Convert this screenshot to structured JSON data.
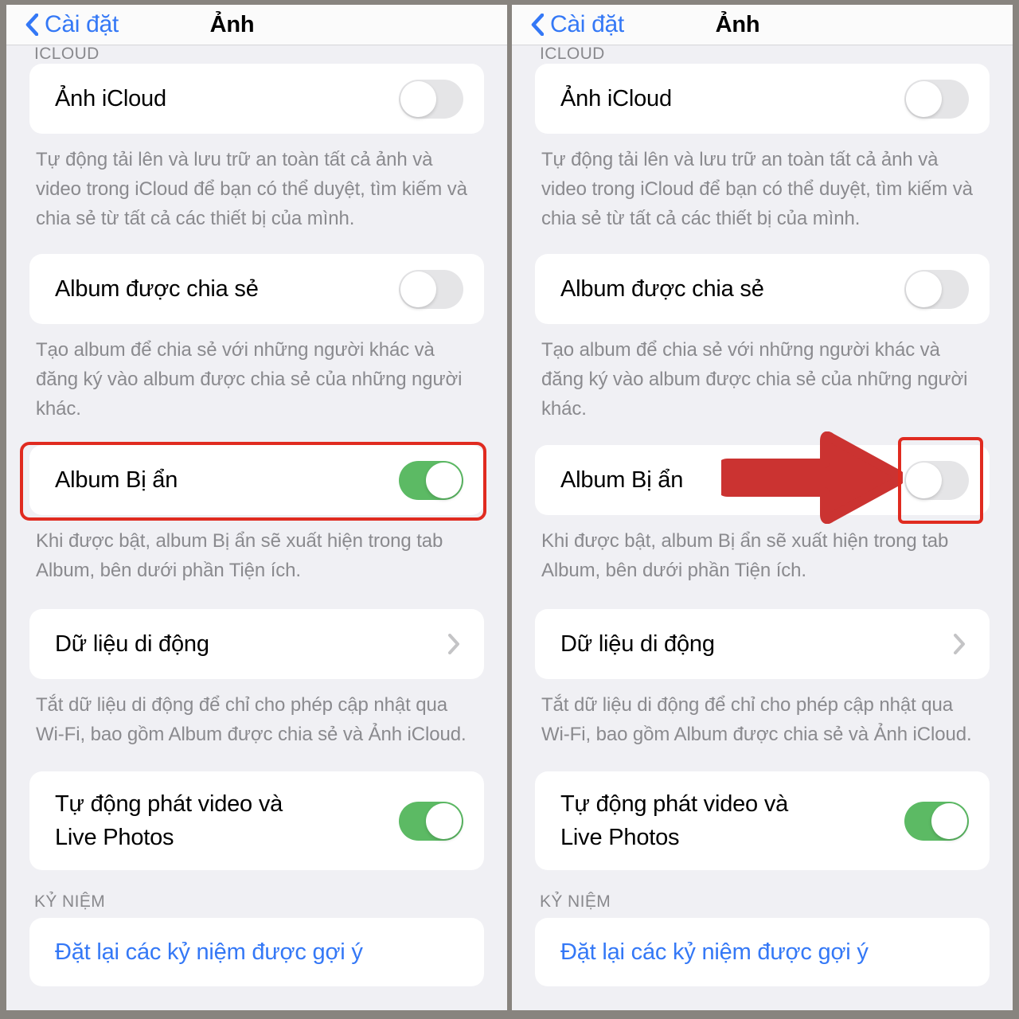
{
  "theme": {
    "bezel": "#88847f",
    "page_bg": "#f0f0f4",
    "card_bg": "#ffffff",
    "accent_blue": "#3478f6",
    "toggle_on_green": "#5cba64",
    "toggle_off_gray": "#e5e5e7",
    "annotation_red": "#e02b20",
    "arrow_red": "#cb3331",
    "footnote_gray": "#8a8a8e"
  },
  "navbar": {
    "back_label": "Cài đặt",
    "back_icon": "chevron-left-icon",
    "title": "Ảnh"
  },
  "sections": {
    "icloud_header": "ICLOUD",
    "memories_header": "KỶ NIỆM"
  },
  "rows": {
    "icloud_photos": {
      "label": "Ảnh iCloud",
      "toggle_state": "off",
      "footnote": "Tự động tải lên và lưu trữ an toàn tất cả ảnh và video trong iCloud để bạn có thể duyệt, tìm kiếm và chia sẻ từ tất cả các thiết bị của mình."
    },
    "shared_albums": {
      "label": "Album được chia sẻ",
      "toggle_state": "off",
      "footnote": "Tạo album để chia sẻ với những người khác và đăng ký vào album được chia sẻ của những người khác."
    },
    "hidden_album": {
      "label": "Album Bị ẩn",
      "toggle_state_left": "on",
      "toggle_state_right": "off",
      "footnote": "Khi được bật, album Bị ẩn sẽ xuất hiện trong tab Album, bên dưới phần Tiện ích."
    },
    "cellular_data": {
      "label": "Dữ liệu di động",
      "disclosure_icon": "chevron-right-icon",
      "footnote": "Tắt dữ liệu di động để chỉ cho phép cập nhật qua Wi-Fi, bao gồm Album được chia sẻ và Ảnh iCloud."
    },
    "autoplay": {
      "label_line1": "Tự động phát video và",
      "label_line2": "Live Photos",
      "toggle_state": "on"
    },
    "reset_memories": {
      "label": "Đặt lại các kỷ niệm được gợi ý"
    }
  },
  "annotations": {
    "left_highlight": "red-rectangle-around-hidden-album-row",
    "right_arrow": "red-arrow-pointing-right",
    "right_highlight": "red-rectangle-around-toggle"
  }
}
